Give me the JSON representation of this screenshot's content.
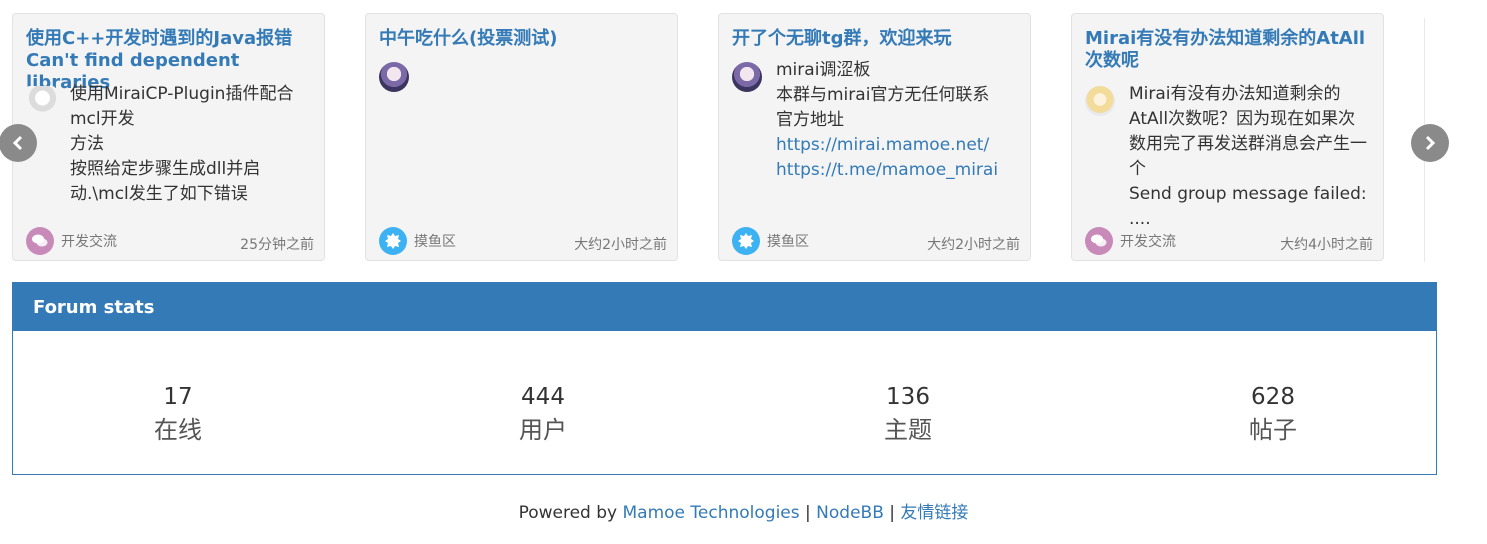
{
  "cards": [
    {
      "title": "使用C++开发时遇到的Java报错 Can't find dependent libraries",
      "excerpt": [
        "使用MiraiCP-Plugin插件配合mcl开发",
        "方法",
        "按照给定步骤生成dll并启动.\\mcl发生了如下错误"
      ],
      "category": "开发交流",
      "category_icon": "comments-icon",
      "category_color": "#c78ab9",
      "time": "25分钟之前"
    },
    {
      "title": "中午吃什么(投票测试)",
      "excerpt": [],
      "category": "摸鱼区",
      "category_icon": "badge-icon",
      "category_color": "#3db2f3",
      "time": "大约2小时之前"
    },
    {
      "title": "开了个无聊tg群，欢迎来玩",
      "excerpt": [
        "mirai调涩板",
        "本群与mirai官方无任何联系",
        "官方地址"
      ],
      "links": [
        "https://mirai.mamoe.net/",
        "https://t.me/mamoe_mirai"
      ],
      "category": "摸鱼区",
      "category_icon": "badge-icon",
      "category_color": "#3db2f3",
      "time": "大约2小时之前"
    },
    {
      "title": "Mirai有没有办法知道剩余的AtAll次数呢",
      "excerpt": [
        "Mirai有没有办法知道剩余的AtAll次数呢？因为现在如果次数用完了再发送群消息会产生一个",
        "Send group message failed: ...."
      ],
      "category": "开发交流",
      "category_icon": "comments-icon",
      "category_color": "#c78ab9",
      "time": "大约4小时之前"
    }
  ],
  "stats": {
    "header": "Forum stats",
    "items": [
      {
        "value": "17",
        "label": "在线"
      },
      {
        "value": "444",
        "label": "用户"
      },
      {
        "value": "136",
        "label": "主题"
      },
      {
        "value": "628",
        "label": "帖子"
      }
    ]
  },
  "footer": {
    "prefix": "Powered by",
    "link1": "Mamoe Technologies",
    "sep1": "|",
    "link2": "NodeBB",
    "sep2": "|",
    "link3": "友情链接"
  }
}
